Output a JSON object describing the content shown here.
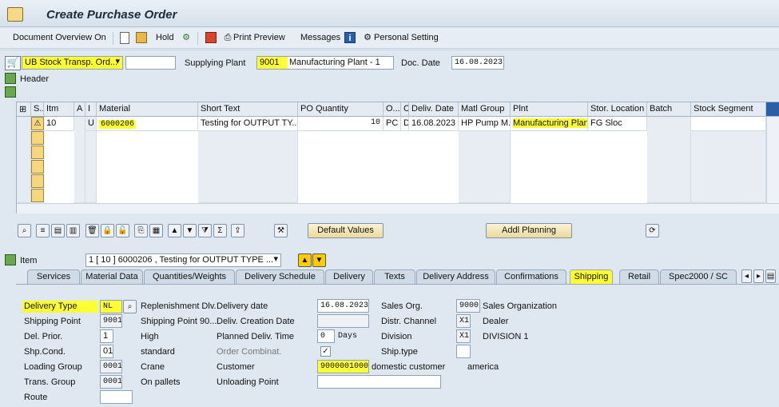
{
  "title": "Create Purchase Order",
  "toolbar": {
    "doc_overview": "Document Overview On",
    "hold": "Hold",
    "print_preview": "Print Preview",
    "messages": "Messages",
    "personal_setting": "Personal Setting"
  },
  "header": {
    "doc_type": "UB Stock Transp. Ord...",
    "doc_number": "",
    "supplying_plant_label": "Supplying Plant",
    "supplying_plant": "9001 Manufacturing Plant - 1",
    "doc_date_label": "Doc. Date",
    "doc_date": "16.08.2023",
    "header_label": "Header"
  },
  "grid": {
    "columns": [
      "S..",
      "Itm",
      "A",
      "I",
      "Material",
      "Short Text",
      "PO Quantity",
      "O...",
      "C",
      "Deliv. Date",
      "Matl Group",
      "Plnt",
      "Stor. Location",
      "Batch",
      "Stock Segment"
    ],
    "row": {
      "item": "10",
      "i": "U",
      "material": "6000206",
      "short_text": "Testing for OUTPUT TY...",
      "qty": "10",
      "unit": "PC",
      "c": "D",
      "deliv_date": "16.08.2023",
      "matl_group": "HP Pump M...",
      "plant": "Manufacturing Plan...",
      "stor_loc": "FG Sloc"
    }
  },
  "buttons": {
    "default_values": "Default Values",
    "addl_planning": "Addl Planning"
  },
  "item_section": {
    "label": "Item",
    "selector": "1 [ 10 ] 6000206 , Testing for OUTPUT TYPE ..."
  },
  "tabs": [
    "Services",
    "Material Data",
    "Quantities/Weights",
    "Delivery Schedule",
    "Delivery",
    "Texts",
    "Delivery Address",
    "Confirmations",
    "Shipping",
    "Retail",
    "Spec2000 / SC"
  ],
  "shipping": {
    "delivery_type_label": "Delivery Type",
    "delivery_type": "NL",
    "shipping_point_label": "Shipping Point",
    "shipping_point": "9001",
    "del_prior_label": "Del. Prior.",
    "del_prior": "1",
    "del_prior_text": "High",
    "shp_cond_label": "Shp.Cond.",
    "shp_cond": "01",
    "shp_cond_text": "standard",
    "loading_group_label": "Loading Group",
    "loading_group": "0001",
    "loading_group_text": "Crane",
    "trans_group_label": "Trans. Group",
    "trans_group": "0001",
    "trans_group_text": "On pallets",
    "route_label": "Route",
    "route": "",
    "repl_dlv": "Replenishment Dlv.",
    "shipping_point_text": "Shipping Point 90...",
    "delivery_date_label": "Delivery date",
    "delivery_date": "16.08.2023",
    "deliv_creation_label": "Deliv. Creation Date",
    "deliv_creation": "",
    "planned_time_label": "Planned Deliv. Time",
    "planned_time": "0",
    "days": "Days",
    "order_combinat_label": "Order Combinat.",
    "customer_label": "Customer",
    "customer": "9000001000",
    "customer_text": "domestic customer",
    "customer_city": "america",
    "unloading_point_label": "Unloading Point",
    "unloading_point": "",
    "sales_org_label": "Sales Org.",
    "sales_org": "9000",
    "sales_org_text": "Sales Organization",
    "distr_channel_label": "Distr. Channel",
    "distr_channel": "X1",
    "distr_channel_text": "Dealer",
    "division_label": "Division",
    "division": "X1",
    "division_text": "DIVISION 1",
    "ship_type_label": "Ship.type",
    "ship_type": ""
  },
  "colors": {
    "highlight": "#ffff33",
    "accent": "#dfe8f1"
  }
}
